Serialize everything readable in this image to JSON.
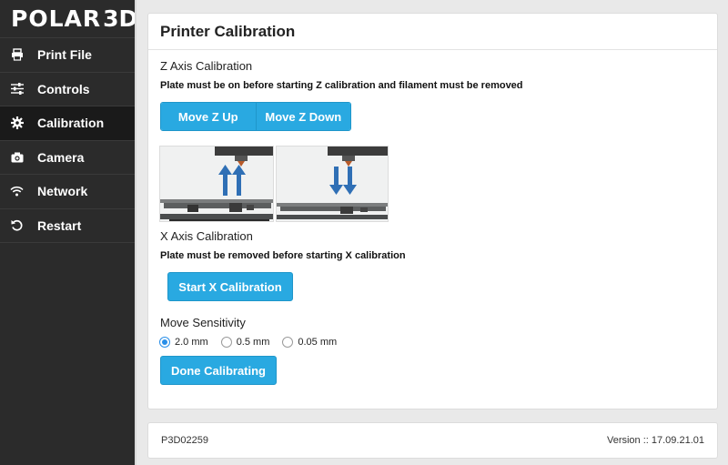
{
  "brand": {
    "name_part1": "POLAR",
    "name_part2": "3D"
  },
  "sidebar": {
    "items": [
      {
        "label": "Print File",
        "icon": "printer-icon"
      },
      {
        "label": "Controls",
        "icon": "sliders-icon"
      },
      {
        "label": "Calibration",
        "icon": "gear-icon",
        "active": true
      },
      {
        "label": "Camera",
        "icon": "camera-icon"
      },
      {
        "label": "Network",
        "icon": "wifi-icon"
      },
      {
        "label": "Restart",
        "icon": "restart-icon"
      }
    ]
  },
  "card": {
    "title": "Printer Calibration",
    "z_axis": {
      "title": "Z Axis Calibration",
      "note": "Plate must be on before starting Z calibration and filament must be removed",
      "move_up_label": "Move Z Up",
      "move_down_label": "Move Z Down"
    },
    "x_axis": {
      "title": "X Axis Calibration",
      "note": "Plate must be removed before starting X calibration",
      "start_label": "Start X Calibration"
    },
    "sensitivity": {
      "title": "Move Sensitivity",
      "options": [
        "2.0 mm",
        "0.5 mm",
        "0.05 mm"
      ],
      "selected": "2.0 mm"
    },
    "done_label": "Done Calibrating"
  },
  "footer": {
    "device_id": "P3D02259",
    "version": "Version :: 17.09.21.01"
  },
  "colors": {
    "accent": "#29a9e1",
    "sidebar_bg": "#2b2b2b",
    "arrow_blue": "#2f6fb5"
  }
}
